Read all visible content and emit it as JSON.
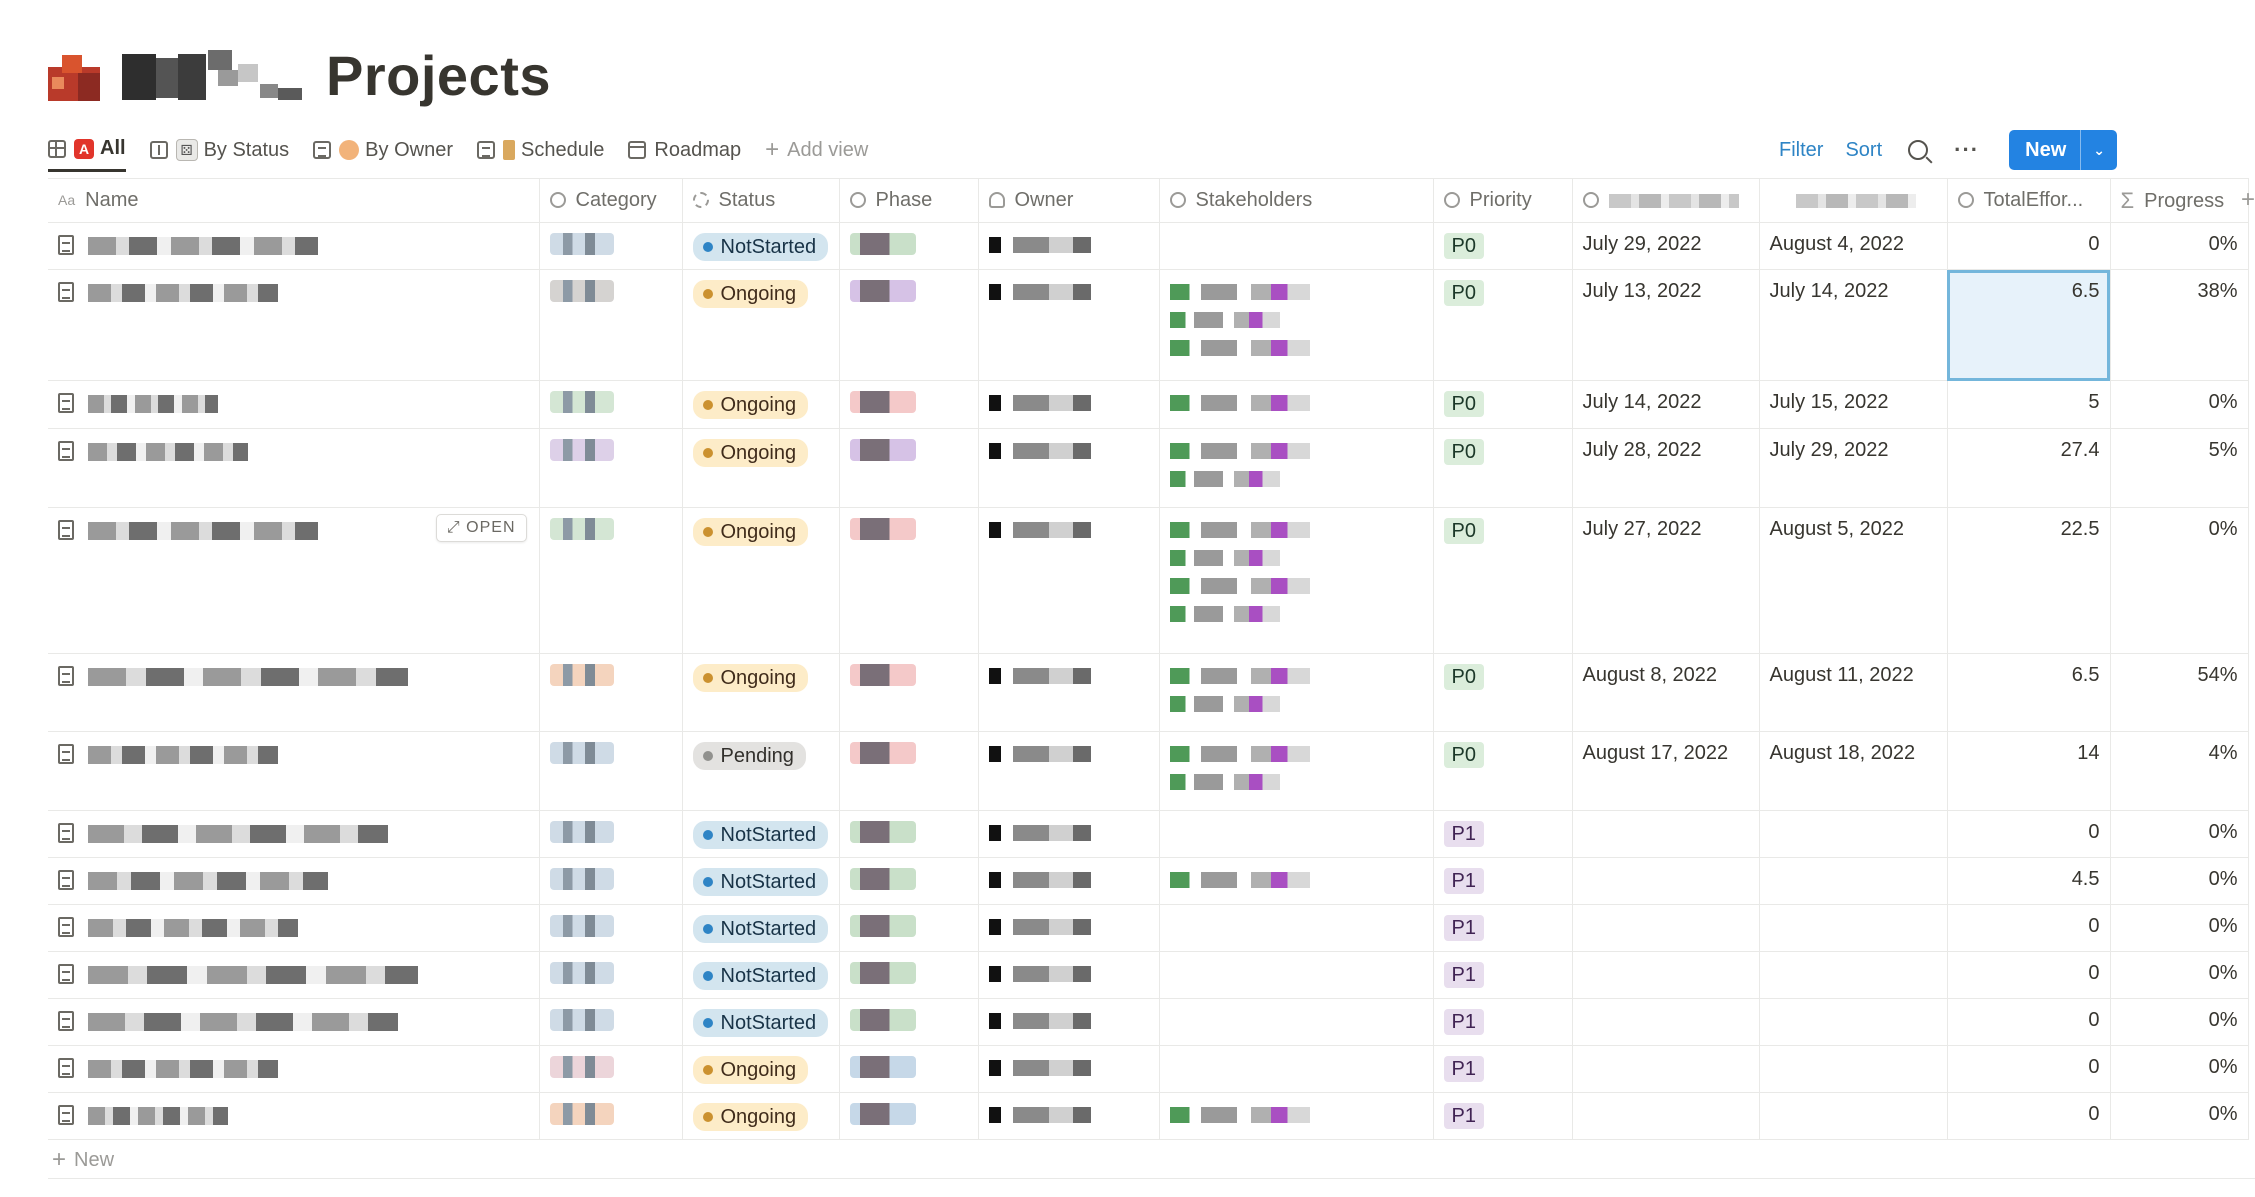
{
  "page": {
    "title": "Projects",
    "icon": "project-emoji-icon",
    "title_prefix_redacted": true
  },
  "views": [
    {
      "label": "All",
      "icon": "table-icon",
      "emoji": "A",
      "active": true
    },
    {
      "label": "By Status",
      "icon": "board-icon",
      "emoji": "die"
    },
    {
      "label": "By Owner",
      "icon": "list-icon",
      "emoji": "person"
    },
    {
      "label": "Schedule",
      "icon": "list-icon",
      "emoji": "hourglass"
    },
    {
      "label": "Roadmap",
      "icon": "calendar-icon"
    },
    {
      "label": "Add view",
      "icon": "plus-icon"
    }
  ],
  "toolbar": {
    "filter": "Filter",
    "sort": "Sort",
    "search_icon": "search-icon",
    "more": "···",
    "new_label": "New",
    "new_arrow": "⌄"
  },
  "columns": {
    "name": "Name",
    "category": "Category",
    "status": "Status",
    "phase": "Phase",
    "owner": "Owner",
    "stakeholders": "Stakeholders",
    "priority": "Priority",
    "date_start": "",
    "date_end": "",
    "total_effort": "TotalEffor...",
    "progress": "Progress"
  },
  "open_button": "OPEN",
  "rows": [
    {
      "status": "NotStarted",
      "priority": "P0",
      "start": "July 29, 2022",
      "end": "August 4, 2022",
      "effort": "0",
      "progress": "0%"
    },
    {
      "status": "Ongoing",
      "priority": "P0",
      "start": "July 13, 2022",
      "end": "July 14, 2022",
      "effort": "6.5",
      "progress": "38%"
    },
    {
      "status": "Ongoing",
      "priority": "P0",
      "start": "July 14, 2022",
      "end": "July 15, 2022",
      "effort": "5",
      "progress": "0%"
    },
    {
      "status": "Ongoing",
      "priority": "P0",
      "start": "July 28, 2022",
      "end": "July 29, 2022",
      "effort": "27.4",
      "progress": "5%"
    },
    {
      "status": "Ongoing",
      "priority": "P0",
      "start": "July 27, 2022",
      "end": "August 5, 2022",
      "effort": "22.5",
      "progress": "0%"
    },
    {
      "status": "Ongoing",
      "priority": "P0",
      "start": "August 8, 2022",
      "end": "August 11, 2022",
      "effort": "6.5",
      "progress": "54%"
    },
    {
      "status": "Pending",
      "priority": "P0",
      "start": "August 17, 2022",
      "end": "August 18, 2022",
      "effort": "14",
      "progress": "4%"
    },
    {
      "status": "NotStarted",
      "priority": "P1",
      "start": "",
      "end": "",
      "effort": "0",
      "progress": "0%"
    },
    {
      "status": "NotStarted",
      "priority": "P1",
      "start": "",
      "end": "",
      "effort": "4.5",
      "progress": "0%"
    },
    {
      "status": "NotStarted",
      "priority": "P1",
      "start": "",
      "end": "",
      "effort": "0",
      "progress": "0%"
    },
    {
      "status": "NotStarted",
      "priority": "P1",
      "start": "",
      "end": "",
      "effort": "0",
      "progress": "0%"
    },
    {
      "status": "NotStarted",
      "priority": "P1",
      "start": "",
      "end": "",
      "effort": "0",
      "progress": "0%"
    },
    {
      "status": "Ongoing",
      "priority": "P1",
      "start": "",
      "end": "",
      "effort": "0",
      "progress": "0%"
    },
    {
      "status": "Ongoing",
      "priority": "P1",
      "start": "",
      "end": "",
      "effort": "0",
      "progress": "0%"
    }
  ],
  "add_row_label": "New",
  "colors": {
    "accent": "#2383e2",
    "link": "#2e84c5",
    "notstarted_bg": "#d3e5ef",
    "ongoing_bg": "#fdecc8",
    "pending_bg": "#e3e2e0",
    "p0_bg": "#dbeddb",
    "p1_bg": "#e8deee"
  }
}
